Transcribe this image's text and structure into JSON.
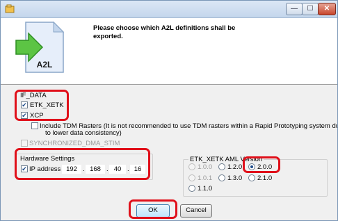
{
  "window": {
    "title": ""
  },
  "header": {
    "message": "Please choose which A2L definitions shall be exported.",
    "icon_label": "A2L"
  },
  "if_data": {
    "group_label": "IF_DATA",
    "etk_xetk": {
      "label": "ETK_XETK",
      "checked": true
    },
    "xcp": {
      "label": "XCP",
      "checked": true
    },
    "tdm_rasters": {
      "label_line1": "Include TDM Rasters (It is not recommended to use TDM rasters within a Rapid Prototyping system due",
      "label_line2": "to lower data consistency)",
      "checked": false
    },
    "sync_dma": {
      "label": "SYNCHRONIZED_DMA_STIM",
      "checked": false,
      "enabled": false
    }
  },
  "hardware": {
    "group_label": "Hardware Settings",
    "ip_checkbox_label": "IP address",
    "ip_checked": true,
    "ip": [
      "192",
      "168",
      "40",
      "16"
    ]
  },
  "aml": {
    "group_label": "ETK_XETK AML Version",
    "options": [
      {
        "label": "1.0.0",
        "enabled": false,
        "checked": false
      },
      {
        "label": "1.2.0",
        "enabled": true,
        "checked": false
      },
      {
        "label": "2.0.0",
        "enabled": true,
        "checked": true
      },
      {
        "label": "1.0.1",
        "enabled": false,
        "checked": false
      },
      {
        "label": "1.3.0",
        "enabled": true,
        "checked": false
      },
      {
        "label": "2.1.0",
        "enabled": true,
        "checked": false
      },
      {
        "label": "1.1.0",
        "enabled": true,
        "checked": false
      }
    ]
  },
  "buttons": {
    "ok": "OK",
    "cancel": "Cancel"
  }
}
